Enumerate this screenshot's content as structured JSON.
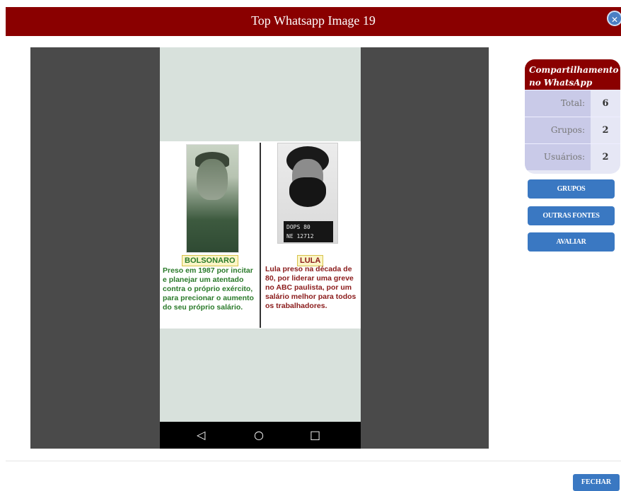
{
  "modal": {
    "title": "Top Whatsapp Image 19",
    "close_icon": "close-icon"
  },
  "image": {
    "left": {
      "name": "BOLSONARO",
      "text": "Preso em 1987 por incitar e planejar um atentado contra o próprio exército, para precionar o aumento do seu próprio salário."
    },
    "right": {
      "name": "LULA",
      "placard_line1": "DOPS 80",
      "placard_line2": "NE 12712",
      "text": "Lula preso na década de 80, por liderar uma greve no ABC paulista, por um salário melhor para todos os trabalhadores."
    },
    "navbar": {
      "back_icon": "◁",
      "home_icon": "○",
      "recents_icon": "□"
    }
  },
  "stats": {
    "title": "Compartilhamento no WhatsApp",
    "rows": [
      {
        "label": "Total:",
        "value": "6"
      },
      {
        "label": "Grupos:",
        "value": "2"
      },
      {
        "label": "Usuários:",
        "value": "2"
      }
    ]
  },
  "buttons": {
    "grupos": "GRUPOS",
    "outras_fontes": "OUTRAS FONTES",
    "avaliar": "AVALIAR",
    "fechar": "FECHAR"
  },
  "colors": {
    "header": "#8a0000",
    "accent": "#3a78c2",
    "panel_label": "#c9cae8",
    "panel_value": "#e6e7f5"
  }
}
